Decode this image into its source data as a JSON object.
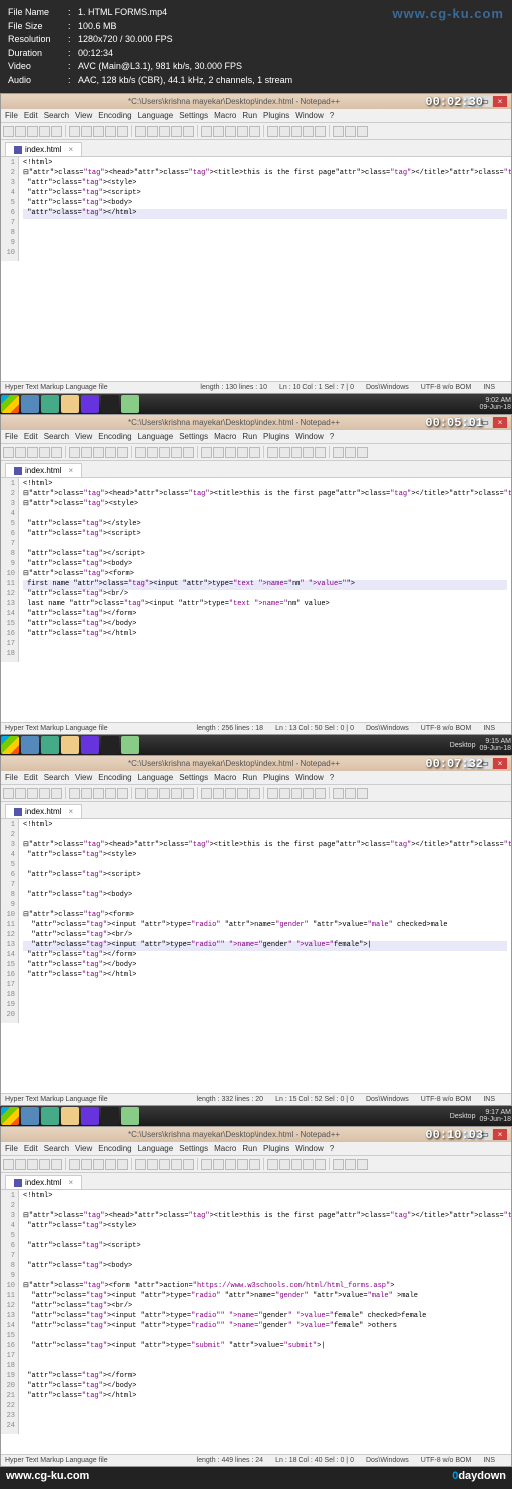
{
  "info": {
    "filename_label": "File Name",
    "filename": "1. HTML FORMS.mp4",
    "filesize_label": "File Size",
    "filesize": "100.6 MB",
    "resolution_label": "Resolution",
    "resolution": "1280x720 / 30.000 FPS",
    "duration_label": "Duration",
    "duration": "00:12:34",
    "video_label": "Video",
    "video": "AVC (Main@L3.1), 981 kb/s, 30.000 FPS",
    "audio_label": "Audio",
    "audio": "AAC, 128 kb/s (CBR), 44.1 kHz, 2 channels, 1 stream",
    "watermark": "www.cg-ku.com"
  },
  "common": {
    "menus": [
      "File",
      "Edit",
      "Search",
      "View",
      "Encoding",
      "Language",
      "Settings",
      "Macro",
      "Run",
      "Plugins",
      "Window",
      "?"
    ],
    "tab_label": "index.html",
    "title_path": "*C:\\Users\\krishna mayekar\\Desktop\\index.html - Notepad++",
    "status_filetype": "Hyper Text Markup Language file"
  },
  "ed1": {
    "timestamp": "00:02:30",
    "lines": [
      "1",
      "2",
      "3",
      "4",
      "5",
      "6",
      "7",
      "8",
      "9",
      "10"
    ],
    "code": [
      "<!html>",
      "⊟<head><title>this is the first page</title></head>",
      " <style>",
      " <script>",
      " <body>",
      " </html>"
    ],
    "status": {
      "length": "length : 130   lines : 10",
      "pos": "Ln : 10   Col : 1   Sel : 7 | 0",
      "eol": "Dos\\Windows",
      "enc": "UTF-8 w/o BOM",
      "ins": "INS"
    },
    "systray_time": "9:02 AM",
    "systray_date": "09-Jun-18"
  },
  "ed2": {
    "timestamp": "00:05:01",
    "lines": [
      "1",
      "2",
      "3",
      "4",
      "5",
      "6",
      "7",
      "8",
      "9",
      "10",
      "11",
      "12",
      "13",
      "14",
      "15",
      "16",
      "17",
      "18"
    ],
    "code": [
      "<!html>",
      "⊟<head><title>this is the first page</title></head>",
      "⊟<style>",
      " ",
      " </style>",
      " <script>",
      " ",
      " </script>",
      " <body>",
      "⊟<form>",
      " first name <input type=\"text name=\"nm\" value=\"\">",
      " <br/>",
      " last name <input type=\"text name=\"nm\" value>",
      " </form>",
      " </body>",
      " </html>"
    ],
    "status": {
      "length": "length : 256   lines : 18",
      "pos": "Ln : 13   Col : 50   Sel : 0 | 0",
      "eol": "Dos\\Windows",
      "enc": "UTF-8 w/o BOM",
      "ins": "INS"
    },
    "tb_right_text": "Desktop",
    "systray_time": "9:15 AM",
    "systray_date": "09-Jun-18"
  },
  "ed3": {
    "timestamp": "00:07:32",
    "lines": [
      "1",
      "2",
      "3",
      "4",
      "5",
      "6",
      "7",
      "8",
      "9",
      "10",
      "11",
      "12",
      "13",
      "14",
      "15",
      "16",
      "17",
      "18",
      "19",
      "20"
    ],
    "code": [
      "<!html>",
      " ",
      "⊟<head><title>this is the first page</title></head>",
      " <style>",
      " ",
      " <script>",
      " ",
      " <body>",
      " ",
      "⊟<form>",
      "  <input type=\"radio\" name=\"gender\" value=\"male\" checked>male",
      "  <br/>",
      "  <input type=\"radio\"\" name=\"gender\" value=\"female\">|",
      " </form>",
      " </body>",
      " </html>"
    ],
    "status": {
      "length": "length : 332   lines : 20",
      "pos": "Ln : 15   Col : 52   Sel : 0 | 0",
      "eol": "Dos\\Windows",
      "enc": "UTF-8 w/o BOM",
      "ins": "INS"
    },
    "tb_right_text": "Desktop",
    "systray_time": "9:17 AM",
    "systray_date": "09-Jun-18"
  },
  "ed4": {
    "timestamp": "00:10:03",
    "lines": [
      "1",
      "2",
      "3",
      "4",
      "5",
      "6",
      "7",
      "8",
      "9",
      "10",
      "11",
      "12",
      "13",
      "14",
      "15",
      "16",
      "17",
      "18",
      "19",
      "20",
      "21",
      "22",
      "23",
      "24"
    ],
    "code": [
      "<!html>",
      " ",
      "⊟<head><title>this is the first page</title></head>",
      " <style>",
      " ",
      " <script>",
      " ",
      " <body>",
      " ",
      "⊟<form action=\"https://www.w3schools.com/html/html_forms.asp\">",
      "  <input type=\"radio\" name=\"gender\" value=\"male\" >male",
      "  <br/>",
      "  <input type=\"radio\"\" name=\"gender\" value=\"female\" checked>female",
      "  <input type=\"radio\"\" name=\"gender\" value=\"female\" >others",
      " ",
      "  <input type=\"submit\" value=\"submit\">|",
      " ",
      " ",
      " </form>",
      " </body>",
      " </html>"
    ],
    "status": {
      "length": "length : 449   lines : 24",
      "pos": "Ln : 18   Col : 40   Sel : 0 | 0",
      "eol": "Dos\\Windows",
      "enc": "UTF-8 w/o BOM",
      "ins": "INS"
    }
  },
  "bottom_logo_left": "www.cg-ku.com",
  "bottom_logo_right_0": "0",
  "bottom_logo_right_rest": "daydown"
}
